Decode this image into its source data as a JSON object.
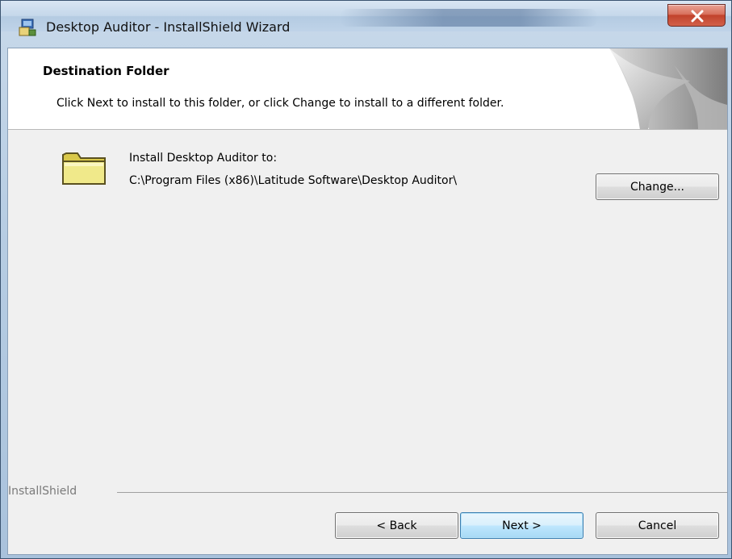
{
  "window": {
    "title": "Desktop Auditor - InstallShield Wizard",
    "close_icon": "close-icon"
  },
  "banner": {
    "title": "Destination Folder",
    "subtitle": "Click Next to install to this folder, or click Change to install to a different folder."
  },
  "destination": {
    "label": "Install Desktop Auditor to:",
    "path": "C:\\Program Files (x86)\\Latitude Software\\Desktop Auditor\\",
    "icon": "folder-icon",
    "change_label": "Change..."
  },
  "footer": {
    "brand": "InstallShield",
    "back_label": "< Back",
    "next_label": "Next >",
    "cancel_label": "Cancel"
  },
  "colors": {
    "close_button": "#c1432c",
    "default_button_border": "#3c7fb1",
    "dialog_background": "#f0f0f0"
  }
}
